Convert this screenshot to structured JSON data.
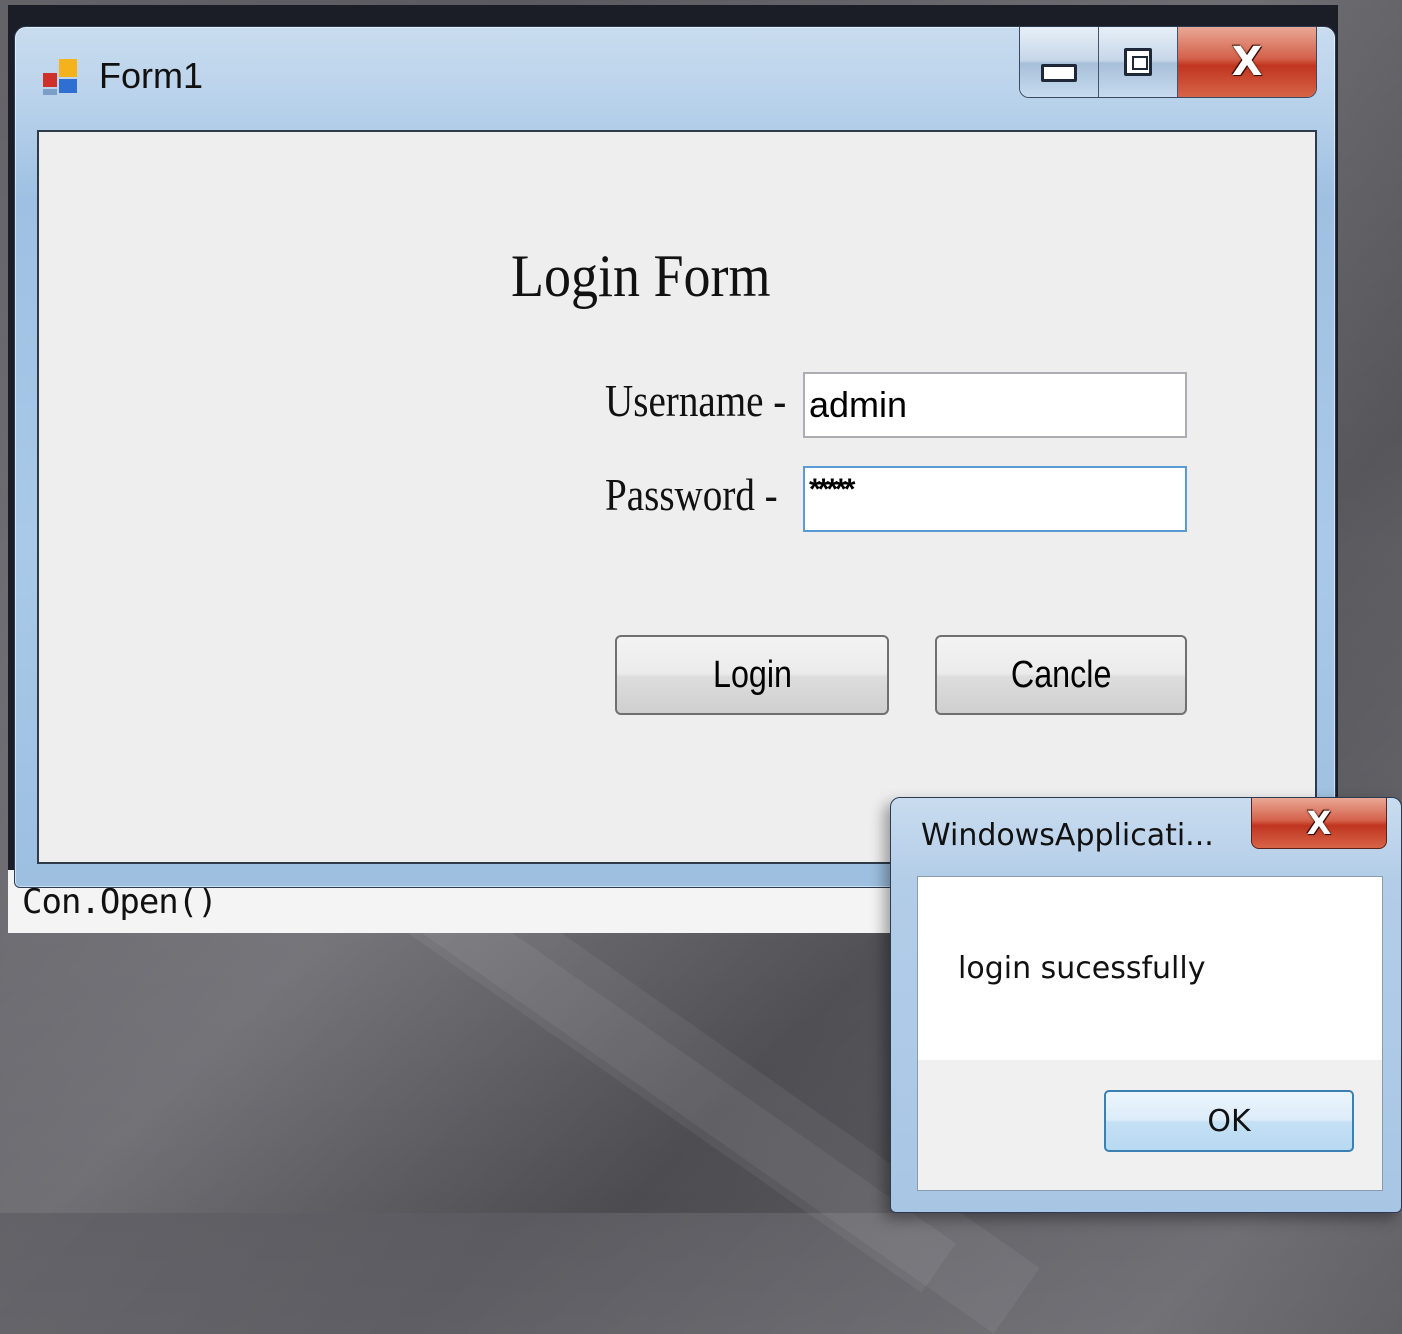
{
  "editor": {
    "code_line": "Con.Open()"
  },
  "window": {
    "title": "Form1",
    "heading": "Login Form",
    "username_label": "Username -",
    "username_value": "admin",
    "password_label": "Password  -",
    "password_value": "*****",
    "login_button": "Login",
    "cancel_button": "Cancle",
    "caption": {
      "close_glyph": "X"
    }
  },
  "messagebox": {
    "title": "WindowsApplicati...",
    "message": "login sucessfully",
    "ok_button": "OK",
    "close_glyph": "X"
  }
}
